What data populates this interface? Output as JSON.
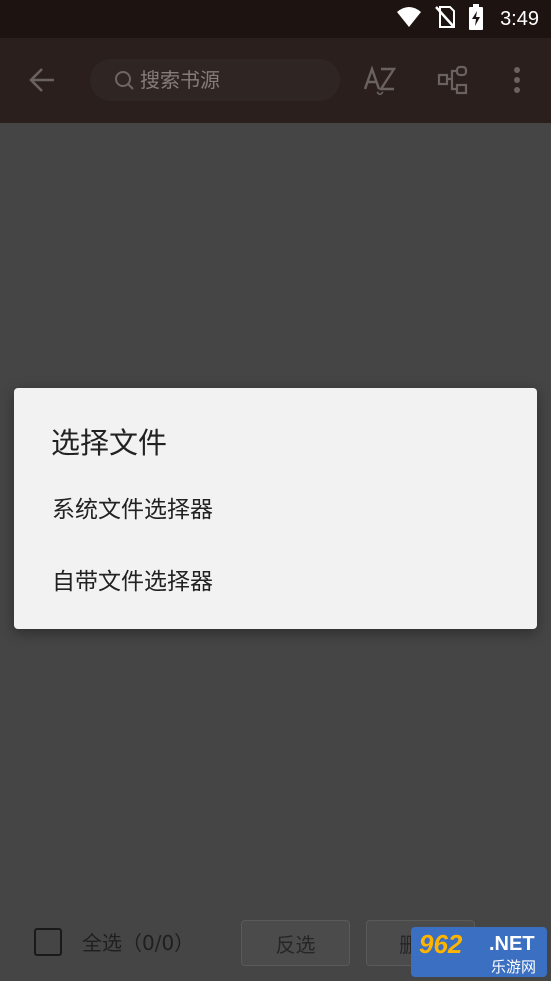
{
  "status_bar": {
    "time": "3:49",
    "icons": [
      "wifi-icon",
      "no-sim-icon",
      "battery-charging-icon"
    ]
  },
  "toolbar": {
    "back_icon": "arrow-left-icon",
    "search": {
      "placeholder": "搜索书源",
      "value": ""
    },
    "sort_icon": "az-sort-icon",
    "group_icon": "group-icon",
    "more_icon": "more-vert-icon"
  },
  "dialog": {
    "title": "选择文件",
    "options": [
      {
        "label": "系统文件选择器"
      },
      {
        "label": "自带文件选择器"
      }
    ]
  },
  "bottom_bar": {
    "select_all_label": "全选（0/0）",
    "select_all_checked": false,
    "invert_label": "反选",
    "delete_label": "删"
  },
  "watermark": {
    "logo_text": "962",
    "suffix": ".NET",
    "site_name": "乐游网"
  },
  "colors": {
    "status_bar_bg": "#1d1412",
    "toolbar_bg": "#2a1f1c",
    "scrim": "#454545",
    "dialog_bg": "#f2f2f2",
    "watermark_blue": "#3a6fc2",
    "watermark_orange": "#ffb400"
  }
}
